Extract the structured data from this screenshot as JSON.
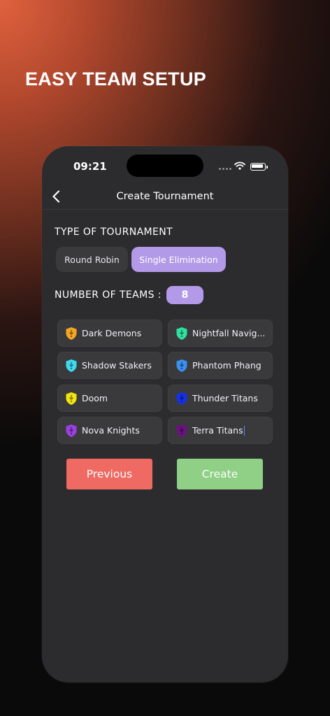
{
  "headline": "EASY TEAM SETUP",
  "status_bar": {
    "time": "09:21"
  },
  "nav": {
    "title": "Create Tournament"
  },
  "tournament_type": {
    "label": "TYPE OF TOURNAMENT",
    "options": [
      "Round Robin",
      "Single Elimination"
    ],
    "selected": "Single Elimination"
  },
  "teams_count": {
    "label": "NUMBER OF TEAMS :",
    "value": "8"
  },
  "teams": [
    {
      "name": "Dark Demons",
      "color": "#f5a623"
    },
    {
      "name": "Nightfall Navig...",
      "color": "#2fe0a0"
    },
    {
      "name": "Shadow Stakers",
      "color": "#3fd9f0"
    },
    {
      "name": "Phantom Phang",
      "color": "#3a8ff0"
    },
    {
      "name": "Doom",
      "color": "#f2e40d"
    },
    {
      "name": "Thunder Titans",
      "color": "#1530e6"
    },
    {
      "name": "Nova Knights",
      "color": "#9b3fe0"
    },
    {
      "name": "Terra Titans",
      "color": "#6a1380"
    }
  ],
  "buttons": {
    "previous": "Previous",
    "create": "Create"
  },
  "colors": {
    "accent": "#b39ae8",
    "previous": "#ef6a63",
    "create": "#8fcf86",
    "card": "#2c2c2e"
  }
}
